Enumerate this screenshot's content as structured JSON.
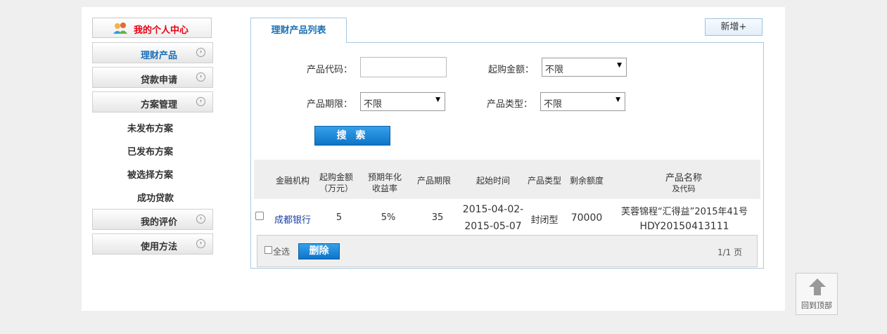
{
  "sidebar": {
    "header": "我的个人中心",
    "items": [
      {
        "label": "理财产品"
      },
      {
        "label": "贷款申请"
      },
      {
        "label": "方案管理"
      },
      {
        "label": "我的评价"
      },
      {
        "label": "使用方法"
      }
    ],
    "sub_items": [
      "未发布方案",
      "已发布方案",
      "被选择方案",
      "成功贷款"
    ]
  },
  "tab": {
    "label": "理财产品列表"
  },
  "add_button": "新增+",
  "filters": {
    "product_code": {
      "label": "产品代码：",
      "value": ""
    },
    "min_amount": {
      "label": "起购金额：",
      "value": "不限"
    },
    "term": {
      "label": "产品期限：",
      "value": "不限"
    },
    "type": {
      "label": "产品类型：",
      "value": "不限"
    },
    "search_button": "搜 索"
  },
  "table": {
    "headers": {
      "institution": "金融机构",
      "min_amount_1": "起购金额",
      "min_amount_2": "（万元）",
      "yield_1": "预期年化",
      "yield_2": "收益率",
      "term": "产品期限",
      "start_time": "起始时间",
      "type": "产品类型",
      "remaining": "剩余额度",
      "name_1": "产品名称",
      "name_2": "及代码"
    },
    "rows": [
      {
        "institution": "成都银行",
        "min_amount": "5",
        "yield": "5%",
        "term": "35",
        "start_1": "2015-04-02-",
        "start_2": "2015-05-07",
        "type": "封闭型",
        "remaining": "70000",
        "name": "芙蓉锦程“汇得益”2015年41号",
        "code": "HDY20150413111"
      }
    ]
  },
  "footer": {
    "select_all": "全选",
    "delete_button": "删除",
    "pager": "1/1 页"
  },
  "back_to_top": "回到顶部",
  "colors": {
    "accent_blue": "#0e74c8",
    "header_red": "#e60012",
    "link_blue": "#1a3fa5"
  }
}
